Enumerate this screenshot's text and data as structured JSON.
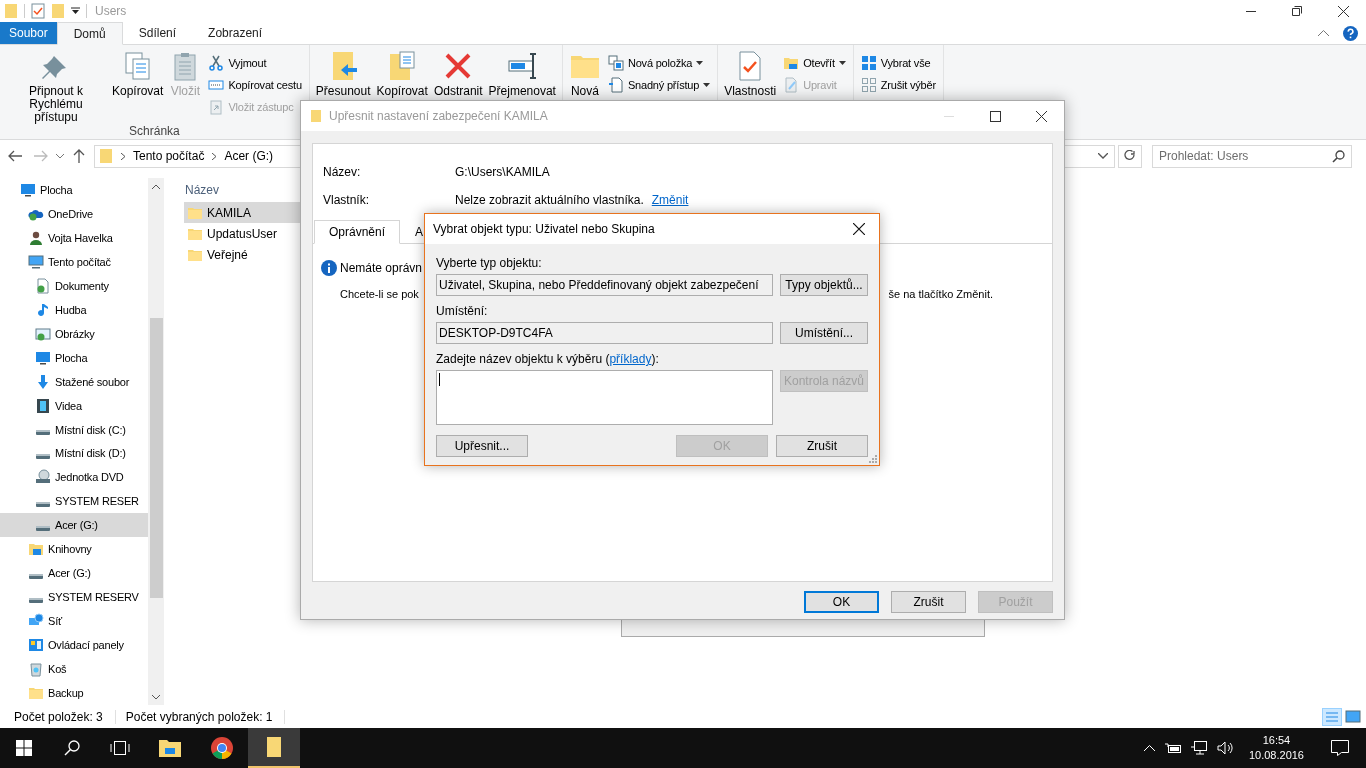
{
  "explorer": {
    "title": "Users",
    "tabs": [
      {
        "label": "Soubor",
        "kind": "file",
        "selected": false
      },
      {
        "label": "Domů",
        "kind": "tab",
        "selected": true
      },
      {
        "label": "Sdílení",
        "kind": "tab",
        "selected": false
      },
      {
        "label": "Zobrazení",
        "kind": "tab",
        "selected": false
      }
    ],
    "ribbon": {
      "groups": [
        {
          "label": "Schránka",
          "large": [
            {
              "label": "Připnout k Rychlému přístupu",
              "disabled": false
            },
            {
              "label": "Kopírovat",
              "disabled": false
            },
            {
              "label": "Vložit",
              "disabled": true
            }
          ],
          "small": [
            {
              "label": "Vyjmout",
              "disabled": false,
              "dropdown": false
            },
            {
              "label": "Kopírovat cestu",
              "disabled": false,
              "dropdown": false
            },
            {
              "label": "Vložit zástupc",
              "disabled": true,
              "dropdown": false
            }
          ]
        },
        {
          "large": [
            {
              "label": "Přesunout",
              "disabled": false
            },
            {
              "label": "Kopírovat",
              "disabled": false
            },
            {
              "label": "Odstranit",
              "disabled": false
            },
            {
              "label": "Přejmenovat",
              "disabled": false
            }
          ]
        },
        {
          "large": [
            {
              "label": "Nová",
              "disabled": false
            }
          ],
          "small": [
            {
              "label": "Nová položka",
              "disabled": false,
              "dropdown": true
            },
            {
              "label": "Snadný přístup",
              "disabled": false,
              "dropdown": true
            }
          ]
        },
        {
          "large": [
            {
              "label": "Vlastnosti",
              "disabled": false
            }
          ],
          "small": [
            {
              "label": "Otevřít",
              "disabled": false,
              "dropdown": true
            },
            {
              "label": "Upravit",
              "disabled": true,
              "dropdown": false
            }
          ]
        },
        {
          "small": [
            {
              "label": "Vybrat vše",
              "disabled": false,
              "dropdown": false
            },
            {
              "label": "Zrušit výběr",
              "disabled": false,
              "dropdown": false
            }
          ]
        }
      ]
    },
    "address": {
      "crumbs": [
        "Tento počítač",
        "Acer (G:)"
      ],
      "search_placeholder": "Prohledat: Users"
    },
    "navigation": [
      {
        "label": "Plocha",
        "selected": false,
        "children": [
          {
            "label": "OneDrive",
            "selected": false
          },
          {
            "label": "Vojta Havelka",
            "selected": false
          },
          {
            "label": "Tento počítač",
            "selected": false,
            "children": [
              {
                "label": "Dokumenty",
                "selected": false
              },
              {
                "label": "Hudba",
                "selected": false
              },
              {
                "label": "Obrázky",
                "selected": false
              },
              {
                "label": "Plocha",
                "selected": false
              },
              {
                "label": "Stažené soubor",
                "selected": false
              },
              {
                "label": "Videa",
                "selected": false
              },
              {
                "label": "Místní disk (C:)",
                "selected": false
              },
              {
                "label": "Místní disk (D:)",
                "selected": false
              },
              {
                "label": "Jednotka DVD",
                "selected": false
              },
              {
                "label": "SYSTEM RESER",
                "selected": false
              },
              {
                "label": "Acer (G:)",
                "selected": true
              }
            ]
          },
          {
            "label": "Knihovny",
            "selected": false
          },
          {
            "label": "Acer (G:)",
            "selected": false
          },
          {
            "label": "SYSTEM RESERV",
            "selected": false
          },
          {
            "label": "Síť",
            "selected": false
          },
          {
            "label": "Ovládací panely",
            "selected": false
          },
          {
            "label": "Koš",
            "selected": false
          },
          {
            "label": "Backup",
            "selected": false
          }
        ]
      }
    ],
    "files": {
      "column": "Název",
      "items": [
        {
          "name": "KAMILA",
          "selected": true
        },
        {
          "name": "UpdatusUser",
          "selected": false
        },
        {
          "name": "Veřejné",
          "selected": false
        }
      ]
    },
    "status_bar": [
      "Počet položek: 3",
      "Počet vybraných položek: 1"
    ]
  },
  "security_dialog": {
    "title": "Upřesnit nastavení zabezpečení KAMILA",
    "fields": [
      {
        "label": "Název:",
        "value": "G:\\Users\\KAMILA"
      },
      {
        "label": "Vlastník:",
        "value": "Nelze zobrazit aktuálního vlastníka.",
        "link": "Změnit"
      }
    ],
    "tabs": [
      {
        "label": "Oprávnění",
        "selected": true
      },
      {
        "label": "A",
        "selected": false
      }
    ],
    "notice": "Nemáte oprávn",
    "text_left": "Chcete-li se pok",
    "text_right": "še na tlačítko Změnit.",
    "buttons": [
      {
        "label": "OK",
        "default": true,
        "disabled": false
      },
      {
        "label": "Zrušit",
        "default": false,
        "disabled": false
      },
      {
        "label": "Použít",
        "default": false,
        "disabled": true
      }
    ]
  },
  "select_dialog": {
    "title": "Vybrat objekt typu: Uživatel nebo Skupina",
    "rows": [
      {
        "label": "Vyberte typ objektu:",
        "value": "Uživatel, Skupina, nebo Předdefinovaný objekt zabezpečení",
        "button": "Typy objektů..."
      },
      {
        "label": "Umístění:",
        "value": "DESKTOP-D9TC4FA",
        "button": "Umístění..."
      }
    ],
    "entry_label": "Zadejte název objektu k výběru (",
    "entry_link": "příklady",
    "entry_label_end": "):",
    "check_button": {
      "label": "Kontrola názvů",
      "disabled": true
    },
    "buttons": [
      {
        "label": "Upřesnit...",
        "disabled": false
      },
      {
        "label": "OK",
        "disabled": true
      },
      {
        "label": "Zrušit",
        "disabled": false
      }
    ]
  },
  "taskbar": {
    "apps": [
      {
        "active": false
      },
      {
        "active": false
      },
      {
        "active": true
      }
    ],
    "time": "16:54",
    "date": "10.08.2016"
  }
}
